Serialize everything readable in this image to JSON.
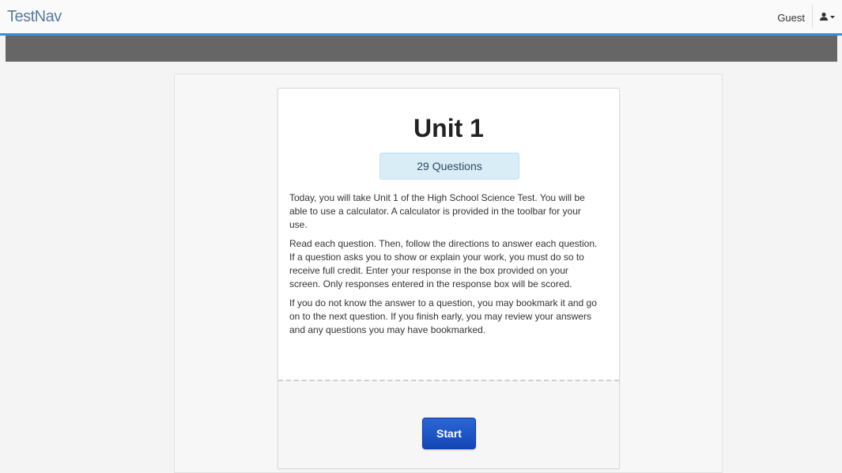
{
  "app": {
    "brand": "TestNav",
    "user_name": "Guest",
    "accent_color": "#3a8fd6"
  },
  "test": {
    "title": "Unit 1",
    "question_count": "29 Questions",
    "paragraphs": [
      "Today, you will take Unit 1 of the High School Science Test. You will be able to use a calculator. A calculator is provided in the toolbar for your use.",
      "Read each question. Then, follow the directions to answer each question. If a question asks you to show or explain your work, you must do so to receive full credit. Enter your response in the box provided on your screen. Only responses entered in the response box will be scored.",
      "If you do not know the answer to a question, you may bookmark it and go on to the next question. If you finish early, you may review your answers and any questions you may have bookmarked."
    ],
    "start_label": "Start",
    "start_color": "#1a4fc4"
  },
  "icons": {
    "user_menu": "user-icon",
    "caret": "caret-down-icon"
  }
}
